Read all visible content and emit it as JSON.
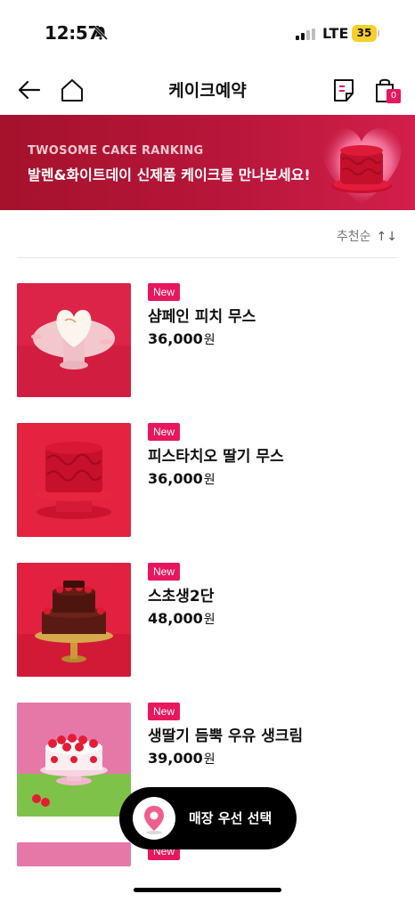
{
  "status_bar": {
    "time": "12:57",
    "network": "LTE",
    "battery": "35"
  },
  "nav": {
    "title": "케이크예약",
    "cart_count": "0"
  },
  "banner": {
    "eyebrow": "TWOSOME CAKE RANKING",
    "headline": "발렌&화이트데이 신제품 케이크를 만나보세요!"
  },
  "sort": {
    "label": "추천순",
    "icon": "sort-arrows-icon"
  },
  "products": [
    {
      "badge": "New",
      "name": "샴페인 피치 무스",
      "price": "36,000",
      "currency": "원"
    },
    {
      "badge": "New",
      "name": "피스타치오 딸기 무스",
      "price": "36,000",
      "currency": "원"
    },
    {
      "badge": "New",
      "name": "스초생2단",
      "price": "48,000",
      "currency": "원"
    },
    {
      "badge": "New",
      "name": "생딸기 듬뿍 우유 생크림",
      "price": "39,000",
      "currency": "원"
    },
    {
      "badge": "New"
    }
  ],
  "store_select": {
    "label": "매장 우선 선택"
  },
  "colors": {
    "accent": "#e8175d",
    "banner": "#b8163a"
  }
}
